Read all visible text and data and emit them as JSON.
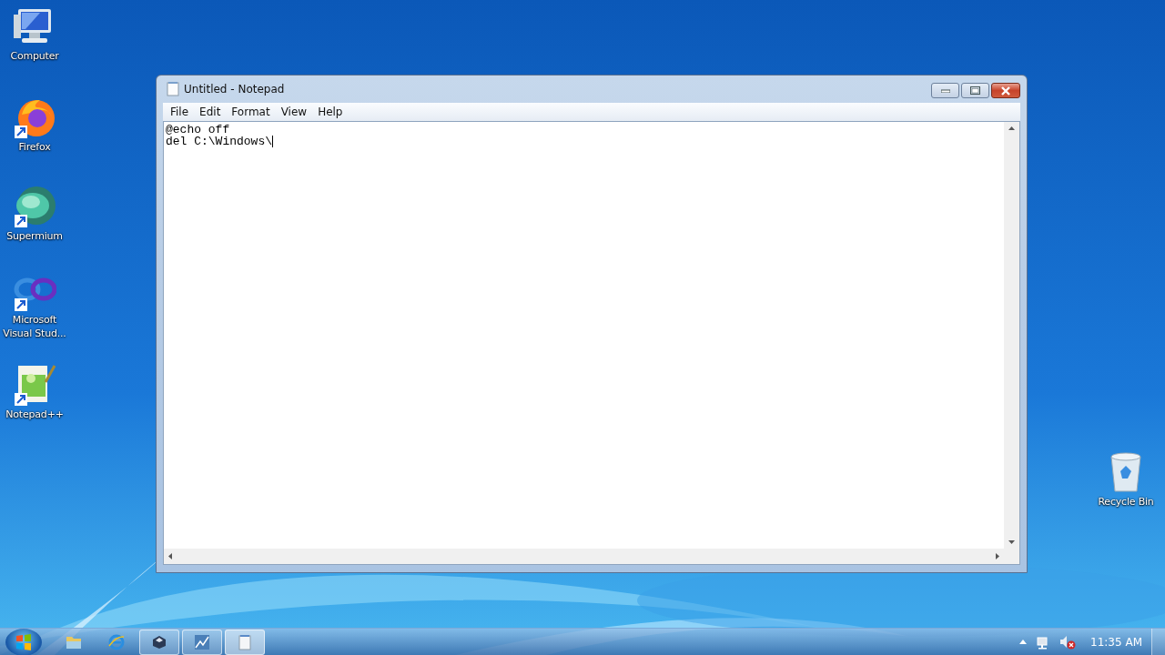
{
  "desktop_icons": [
    {
      "kind": "computer",
      "label": "Computer"
    },
    {
      "kind": "firefox",
      "label": "Firefox"
    },
    {
      "kind": "supermium",
      "label": "Supermium"
    },
    {
      "kind": "visual-studio",
      "label": "Microsoft Visual Stud..."
    },
    {
      "kind": "notepadpp",
      "label": "Notepad++"
    }
  ],
  "desktop_icons_right": [
    {
      "kind": "recycle-bin",
      "label": "Recycle Bin"
    }
  ],
  "window": {
    "title": "Untitled - Notepad",
    "menu": [
      "File",
      "Edit",
      "Format",
      "View",
      "Help"
    ],
    "text_lines": [
      "@echo off",
      "del C:\\Windows\\"
    ]
  },
  "taskbar": {
    "items": [
      {
        "kind": "explorer",
        "running": false,
        "selected": false
      },
      {
        "kind": "ie",
        "running": false,
        "selected": false
      },
      {
        "kind": "virtualbox",
        "running": true,
        "selected": false
      },
      {
        "kind": "app",
        "running": true,
        "selected": false
      },
      {
        "kind": "notepad",
        "running": true,
        "selected": true
      }
    ],
    "clock": "11:35 AM"
  }
}
